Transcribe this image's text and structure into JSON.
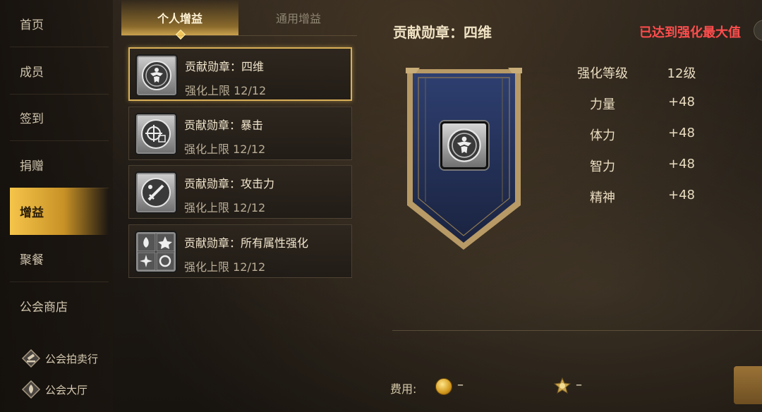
{
  "sidebar": {
    "items": [
      {
        "label": "首页"
      },
      {
        "label": "成员"
      },
      {
        "label": "签到"
      },
      {
        "label": "捐赠"
      },
      {
        "label": "增益"
      },
      {
        "label": "聚餐"
      },
      {
        "label": "公会商店"
      }
    ],
    "active_index": 4,
    "bottom_links": [
      {
        "label": "公会拍卖行",
        "icon": "auction-icon"
      },
      {
        "label": "公会大厅",
        "icon": "hall-icon"
      }
    ]
  },
  "tabs": [
    {
      "label": "个人增益",
      "active": true
    },
    {
      "label": "通用增益",
      "active": false
    }
  ],
  "buff_list": [
    {
      "name": "贡献勋章：四维",
      "limit": "强化上限 12/12",
      "icon": "four-stats-medal-icon",
      "selected": true
    },
    {
      "name": "贡献勋章：暴击",
      "limit": "强化上限 12/12",
      "icon": "crit-medal-icon",
      "selected": false
    },
    {
      "name": "贡献勋章：攻击力",
      "limit": "强化上限 12/12",
      "icon": "attack-medal-icon",
      "selected": false
    },
    {
      "name": "贡献勋章：所有属性强化",
      "limit": "强化上限 12/12",
      "icon": "all-attributes-medal-icon",
      "selected": false
    }
  ],
  "detail": {
    "title": "贡献勋章：四维",
    "max_status": "已达到强化最大值",
    "stats": [
      {
        "name": "强化等级",
        "value": "12级"
      },
      {
        "name": "力量",
        "value": "+48"
      },
      {
        "name": "体力",
        "value": "+48"
      },
      {
        "name": "智力",
        "value": "+48"
      },
      {
        "name": "精神",
        "value": "+48"
      }
    ]
  },
  "cost": {
    "label": "费用:",
    "gold_value": "–",
    "medal_value": "–"
  },
  "colors": {
    "accent_gold": "#d9b058",
    "max_red": "#ff4d4d"
  }
}
